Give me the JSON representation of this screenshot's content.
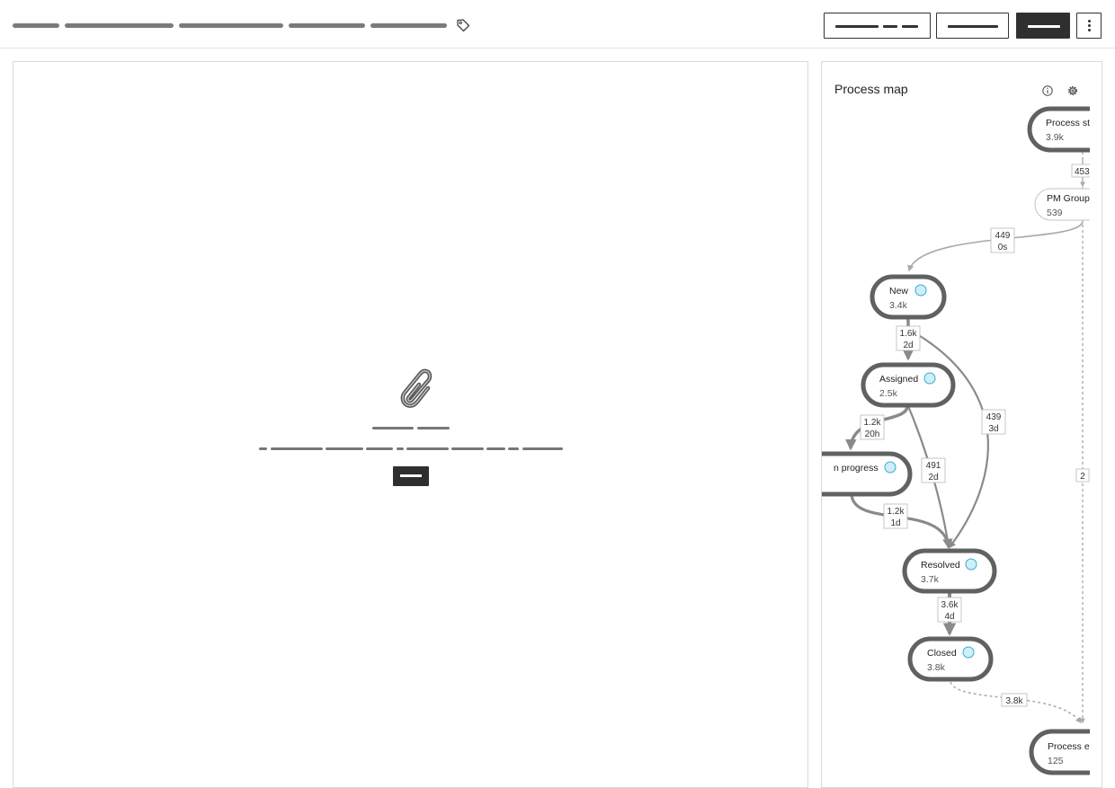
{
  "panel": {
    "title": "Process map"
  },
  "nodes": [
    {
      "id": "start",
      "label": "Process st",
      "count": "3.9k"
    },
    {
      "id": "pm_group",
      "label": "PM Group",
      "count": "539"
    },
    {
      "id": "new",
      "label": "New",
      "count": "3.4k"
    },
    {
      "id": "assigned",
      "label": "Assigned",
      "count": "2.5k"
    },
    {
      "id": "in_progress",
      "label": "n progress",
      "count": ""
    },
    {
      "id": "resolved",
      "label": "Resolved",
      "count": "3.7k"
    },
    {
      "id": "closed",
      "label": "Closed",
      "count": "3.8k"
    },
    {
      "id": "end",
      "label": "Process e",
      "count": "125"
    }
  ],
  "edges": [
    {
      "id": "start_pm",
      "count": "453",
      "duration": ""
    },
    {
      "id": "pm_new",
      "count": "449",
      "duration": "0s"
    },
    {
      "id": "new_assigned",
      "count": "1.6k",
      "duration": "2d"
    },
    {
      "id": "new_resolved",
      "count": "439",
      "duration": "3d"
    },
    {
      "id": "assigned_inprogress",
      "count": "1.2k",
      "duration": "20h"
    },
    {
      "id": "assigned_resolved",
      "count": "491",
      "duration": "2d"
    },
    {
      "id": "inprogress_resolved",
      "count": "1.2k",
      "duration": "1d"
    },
    {
      "id": "resolved_closed",
      "count": "3.6k",
      "duration": "4d"
    },
    {
      "id": "closed_end",
      "count": "3.8k",
      "duration": ""
    },
    {
      "id": "start_end",
      "count": "2",
      "duration": ""
    }
  ],
  "colors": {
    "node_border": "#5f6163",
    "edge": "#a8a8a8",
    "edge_strong": "#8a8a8a",
    "indicator": "#cfeef8",
    "indicator_border": "#3aa9cf",
    "primary_button": "#2f2f2f"
  },
  "icons": [
    "tag-icon",
    "more-vertical-icon",
    "paperclip-icon",
    "info-icon",
    "settings-icon"
  ]
}
